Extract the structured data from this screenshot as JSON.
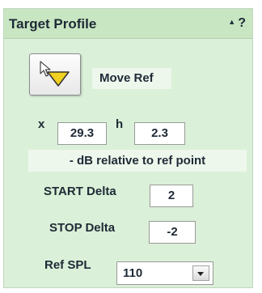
{
  "panel": {
    "title": "Target Profile",
    "collapse_icon": "triangle-up",
    "help_label": "?"
  },
  "tool": {
    "icon": "pointer-with-yellow-triangle",
    "label": "Move Ref"
  },
  "position": {
    "x_label": "x",
    "x_value": "29.3",
    "h_label": "h",
    "h_value": "2.3"
  },
  "info_text": "- dB relative to ref point",
  "start_delta": {
    "label": "START Delta",
    "value": "2"
  },
  "stop_delta": {
    "label": "STOP Delta",
    "value": "-2"
  },
  "ref_spl": {
    "label": "Ref SPL",
    "value": "110"
  },
  "colors": {
    "panel_background": "#dbf0d8",
    "title_bar": "#c8e6c2",
    "text": "#1e2a36",
    "tool_triangle": "#f0d020"
  }
}
